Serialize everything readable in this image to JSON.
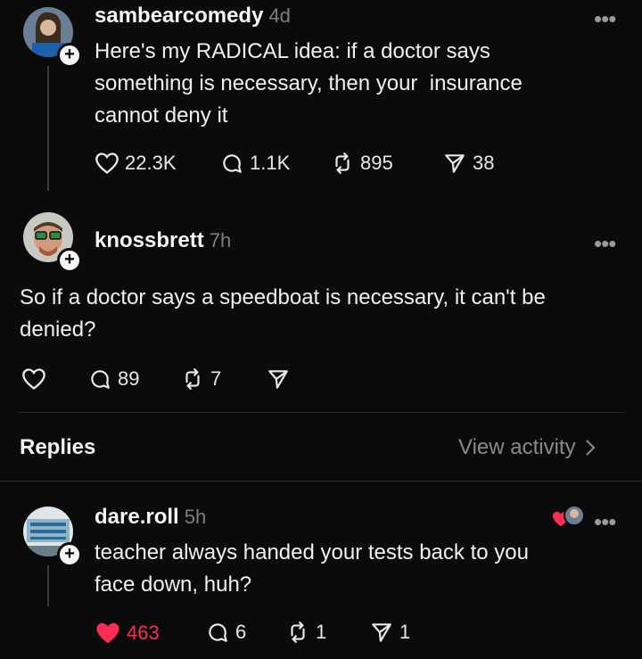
{
  "post1": {
    "username": "sambearcomedy",
    "time": "4d",
    "text_line1": "Here's my RADICAL idea: if a doctor says",
    "text_line2": "something is necessary, then your  insurance",
    "text_line3": "cannot deny it",
    "likes": "22.3K",
    "comments": "1.1K",
    "reposts": "895",
    "shares": "38"
  },
  "post2": {
    "username": "knossbrett",
    "time": "7h",
    "text_line1": "So if a doctor says a speedboat is necessary, it can't be",
    "text_line2": "denied?",
    "comments": "89",
    "reposts": "7"
  },
  "replies_header": {
    "title": "Replies",
    "view_activity": "View activity"
  },
  "reply1": {
    "username": "dare.roll",
    "time": "5h",
    "text_line1": "teacher always handed your tests back to you",
    "text_line2": "face down, huh?",
    "likes": "463",
    "comments": "6",
    "reposts": "1",
    "shares": "1"
  },
  "icons": {
    "heart": "heart-icon",
    "comment": "comment-icon",
    "repost": "repost-icon",
    "share": "share-icon",
    "more": "more-icon",
    "chevron": "chevron-right-icon"
  },
  "colors": {
    "background": "#0b0b0b",
    "liked": "#ff2d55",
    "muted": "#7d7d7d"
  }
}
